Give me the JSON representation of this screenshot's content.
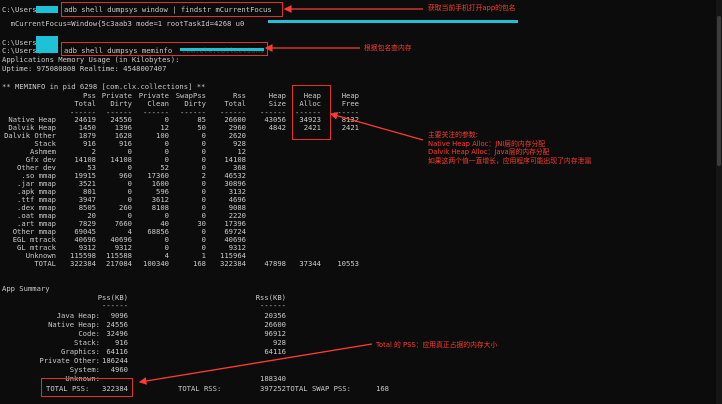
{
  "lines": {
    "prompt": "C:\\Users\\",
    "cmd1": "adb shell dumpsys window | findstr mCurrentFocus",
    "focus": "  mCurrentFocus=Window{5c3aab3 mode=1 rootTaskId=4268 u0",
    "cmd2": "adb shell dumpsys meminfo",
    "cmd2_pkg": "com.clx.collections",
    "amu": "Applications Memory Usage (in Kilobytes):",
    "uptime": "Uptime: 975080808 Realtime: 4548007407",
    "meminfo_title": "** MEMINFO in pid 6298 [com.clx.collections] **",
    "app_summary": "App Summary"
  },
  "mem_table": {
    "header1": [
      "",
      "Pss",
      "Private",
      "Private",
      "SwapPss",
      "Rss",
      "Heap",
      "Heap",
      "Heap"
    ],
    "header2": [
      "",
      "Total",
      "Dirty",
      "Clean",
      "Dirty",
      "Total",
      "Size",
      "Alloc",
      "Free"
    ],
    "dash": "------",
    "rows": [
      [
        "Native Heap",
        "24619",
        "24556",
        "0",
        "85",
        "26600",
        "43056",
        "34923",
        "8132"
      ],
      [
        "Dalvik Heap",
        "1450",
        "1396",
        "12",
        "50",
        "2960",
        "4842",
        "2421",
        "2421"
      ],
      [
        "Dalvik Other",
        "1879",
        "1628",
        "100",
        "0",
        "2620",
        "",
        "",
        ""
      ],
      [
        "Stack",
        "916",
        "916",
        "0",
        "0",
        "928",
        "",
        "",
        ""
      ],
      [
        "Ashmem",
        "2",
        "0",
        "0",
        "0",
        "12",
        "",
        "",
        ""
      ],
      [
        "Gfx dev",
        "14108",
        "14108",
        "0",
        "0",
        "14108",
        "",
        "",
        ""
      ],
      [
        "Other dev",
        "53",
        "0",
        "52",
        "0",
        "368",
        "",
        "",
        ""
      ],
      [
        ".so mmap",
        "19915",
        "960",
        "17360",
        "2",
        "46532",
        "",
        "",
        ""
      ],
      [
        ".jar mmap",
        "3521",
        "0",
        "1600",
        "0",
        "30896",
        "",
        "",
        ""
      ],
      [
        ".apk mmap",
        "801",
        "0",
        "596",
        "0",
        "3132",
        "",
        "",
        ""
      ],
      [
        ".ttf mmap",
        "3947",
        "0",
        "3612",
        "0",
        "4696",
        "",
        "",
        ""
      ],
      [
        ".dex mmap",
        "8505",
        "260",
        "8108",
        "0",
        "9088",
        "",
        "",
        ""
      ],
      [
        ".oat mmap",
        "20",
        "0",
        "0",
        "0",
        "2220",
        "",
        "",
        ""
      ],
      [
        ".art mmap",
        "7829",
        "7660",
        "40",
        "30",
        "17396",
        "",
        "",
        ""
      ],
      [
        "Other mmap",
        "69045",
        "4",
        "68856",
        "0",
        "69724",
        "",
        "",
        ""
      ],
      [
        "EGL mtrack",
        "40696",
        "40696",
        "0",
        "0",
        "40696",
        "",
        "",
        ""
      ],
      [
        "GL mtrack",
        "9312",
        "9312",
        "0",
        "0",
        "9312",
        "",
        "",
        ""
      ],
      [
        "Unknown",
        "115598",
        "115588",
        "4",
        "1",
        "115964",
        "",
        "",
        ""
      ],
      [
        "TOTAL",
        "322384",
        "217084",
        "100340",
        "168",
        "322384",
        "47898",
        "37344",
        "10553"
      ]
    ]
  },
  "summary": {
    "h_pss": "Pss(KB)",
    "h_rss": "Rss(KB)",
    "dash": "------",
    "rows": [
      [
        "Java Heap:",
        "9096",
        "20356"
      ],
      [
        "Native Heap:",
        "24556",
        "26600"
      ],
      [
        "Code:",
        "32496",
        "96912"
      ],
      [
        "Stack:",
        "916",
        "928"
      ],
      [
        "Graphics:",
        "64116",
        "64116"
      ],
      [
        "Private Other:",
        "186244",
        ""
      ],
      [
        "System:",
        "4960",
        ""
      ],
      [
        "Unknown:",
        "",
        "188340"
      ]
    ],
    "total_pss_label": "TOTAL PSS:",
    "total_pss": "322384",
    "total_rss_label": "TOTAL RSS:",
    "total_rss": "397252",
    "total_swap_label": "TOTAL SWAP PSS:",
    "total_swap": "168"
  },
  "annotations": {
    "a1": "获取当前手机打开app的包名",
    "a2": "根据包名查内存",
    "a3": [
      "主要关注的参数:",
      "Native Heap Alloc：JNI层的内存分配",
      "Dalvik Heap Alloc：Java层的内存分配",
      "如果这两个值一直增长，应用程序可能出现了内存泄漏"
    ],
    "a4": "Total 的 PSS：应用真正占据的内存大小"
  },
  "colors": {
    "annotation_red": "#ff3b2f",
    "highlight_cyan": "#1fc1d6",
    "terminal_bg": "#0c0c0c"
  }
}
